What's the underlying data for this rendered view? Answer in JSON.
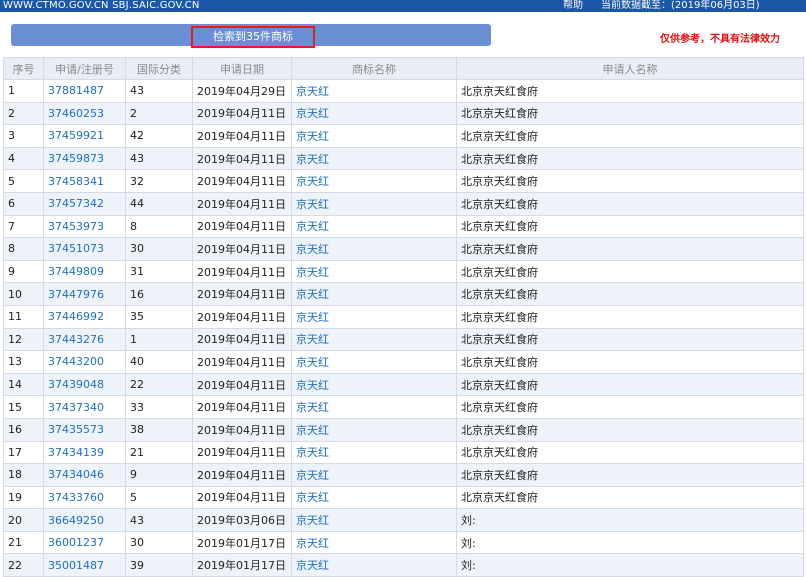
{
  "header": {
    "site": "WWW.CTMO.GOV.CN SBJ.SAIC.GOV.CN",
    "help": "帮助",
    "data_date": "当前数据截至：(2019年06月03日)"
  },
  "result_bar": {
    "count_text": "检索到35件商标"
  },
  "disclaimer": "仅供参考，不具有法律效力",
  "table": {
    "headers": [
      "序号",
      "申请/注册号",
      "国际分类",
      "申请日期",
      "商标名称",
      "申请人名称"
    ],
    "rows": [
      [
        "1",
        "37881487",
        "43",
        "2019年04月29日",
        "京天红",
        "北京京天红食府"
      ],
      [
        "2",
        "37460253",
        "2",
        "2019年04月11日",
        "京天红",
        "北京京天红食府"
      ],
      [
        "3",
        "37459921",
        "42",
        "2019年04月11日",
        "京天红",
        "北京京天红食府"
      ],
      [
        "4",
        "37459873",
        "43",
        "2019年04月11日",
        "京天红",
        "北京京天红食府"
      ],
      [
        "5",
        "37458341",
        "32",
        "2019年04月11日",
        "京天红",
        "北京京天红食府"
      ],
      [
        "6",
        "37457342",
        "44",
        "2019年04月11日",
        "京天红",
        "北京京天红食府"
      ],
      [
        "7",
        "37453973",
        "8",
        "2019年04月11日",
        "京天红",
        "北京京天红食府"
      ],
      [
        "8",
        "37451073",
        "30",
        "2019年04月11日",
        "京天红",
        "北京京天红食府"
      ],
      [
        "9",
        "37449809",
        "31",
        "2019年04月11日",
        "京天红",
        "北京京天红食府"
      ],
      [
        "10",
        "37447976",
        "16",
        "2019年04月11日",
        "京天红",
        "北京京天红食府"
      ],
      [
        "11",
        "37446992",
        "35",
        "2019年04月11日",
        "京天红",
        "北京京天红食府"
      ],
      [
        "12",
        "37443276",
        "1",
        "2019年04月11日",
        "京天红",
        "北京京天红食府"
      ],
      [
        "13",
        "37443200",
        "40",
        "2019年04月11日",
        "京天红",
        "北京京天红食府"
      ],
      [
        "14",
        "37439048",
        "22",
        "2019年04月11日",
        "京天红",
        "北京京天红食府"
      ],
      [
        "15",
        "37437340",
        "33",
        "2019年04月11日",
        "京天红",
        "北京京天红食府"
      ],
      [
        "16",
        "37435573",
        "38",
        "2019年04月11日",
        "京天红",
        "北京京天红食府"
      ],
      [
        "17",
        "37434139",
        "21",
        "2019年04月11日",
        "京天红",
        "北京京天红食府"
      ],
      [
        "18",
        "37434046",
        "9",
        "2019年04月11日",
        "京天红",
        "北京京天红食府"
      ],
      [
        "19",
        "37433760",
        "5",
        "2019年04月11日",
        "京天红",
        "北京京天红食府"
      ],
      [
        "20",
        "36649250",
        "43",
        "2019年03月06日",
        "京天红",
        "刘:"
      ],
      [
        "21",
        "36001237",
        "30",
        "2019年01月17日",
        "京天红",
        "刘:"
      ],
      [
        "22",
        "35001487",
        "39",
        "2019年01月17日",
        "京天红",
        "刘:"
      ]
    ]
  }
}
